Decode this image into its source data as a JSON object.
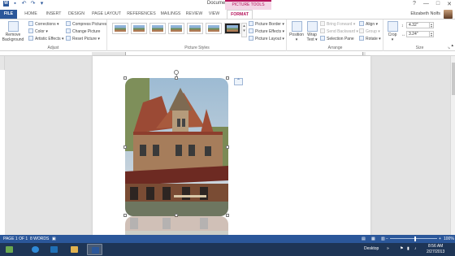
{
  "window": {
    "title": "Document1 - Word",
    "context_tab_group": "PICTURE TOOLS",
    "user_name": "Elizabeth Nolfs",
    "controls": [
      "?",
      "—",
      "□",
      "✕"
    ]
  },
  "tabs": [
    "FILE",
    "HOME",
    "INSERT",
    "DESIGN",
    "PAGE LAYOUT",
    "REFERENCES",
    "MAILINGS",
    "REVIEW",
    "VIEW",
    "FORMAT"
  ],
  "ribbon": {
    "adjust": {
      "remove_background": "Remove Background",
      "corrections": "Corrections ▾",
      "color": "Color ▾",
      "artistic_effects": "Artistic Effects ▾",
      "compress_pictures": "Compress Pictures",
      "change_picture": "Change Picture",
      "reset_picture": "Reset Picture ▾",
      "label": "Adjust"
    },
    "picture_styles": {
      "picture_border": "Picture Border ▾",
      "picture_effects": "Picture Effects ▾",
      "picture_layout": "Picture Layout ▾",
      "label": "Picture Styles"
    },
    "arrange": {
      "position": "Position",
      "position_caret": "▾",
      "wrap_text": "Wrap Text ▾",
      "bring_forward": "Bring Forward ▾",
      "send_backward": "Send Backward ▾",
      "selection_pane": "Selection Pane",
      "align": "Align ▾",
      "group": "Group ▾",
      "rotate": "Rotate ▾",
      "label": "Arrange"
    },
    "size": {
      "crop": "Crop",
      "crop_caret": "▾",
      "height": "4.32\"",
      "width": "3.24\"",
      "label": "Size"
    }
  },
  "status": {
    "page": "PAGE 1 OF 1",
    "words": "8 WORDS",
    "zoom": "100%"
  },
  "taskbar": {
    "desktop_label": "Desktop",
    "time": "8:56 AM",
    "date": "2/27/2013"
  },
  "colors": {
    "accent_blue": "#2b579a",
    "picture_tools": "#b4135a",
    "taskbar": "#1e3556"
  }
}
